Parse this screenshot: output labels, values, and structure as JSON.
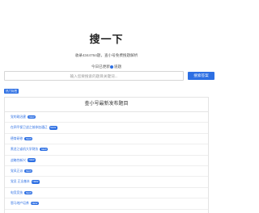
{
  "title": "搜一下",
  "stats_text": "收录4344764题，查小号免费搜题解析",
  "today": {
    "prefix": "今日已更新",
    "suffix": "道题"
  },
  "search": {
    "placeholder": "输入您要搜索的题目关键词...",
    "button": "搜索答案"
  },
  "tag": "热门标签",
  "panel_title": "查小号最新发布题目",
  "items": [
    {
      "label": "党的政治建",
      "badge": "NEW"
    },
    {
      "label": "在四平保卫战之前参加通辽",
      "badge": "NEW"
    },
    {
      "label": "德育研修",
      "badge": "NEW"
    },
    {
      "label": "黑龙江省机大学财务",
      "badge": "NEW"
    },
    {
      "label": "战略性新兴",
      "badge": "NEW"
    },
    {
      "label": "党风正派",
      "badge": "NEW"
    },
    {
      "label": "党员 正念基本",
      "badge": "NEW"
    },
    {
      "label": "电竞竞技",
      "badge": "NEW"
    },
    {
      "label": "恩马地产培养",
      "badge": "NEW"
    }
  ]
}
